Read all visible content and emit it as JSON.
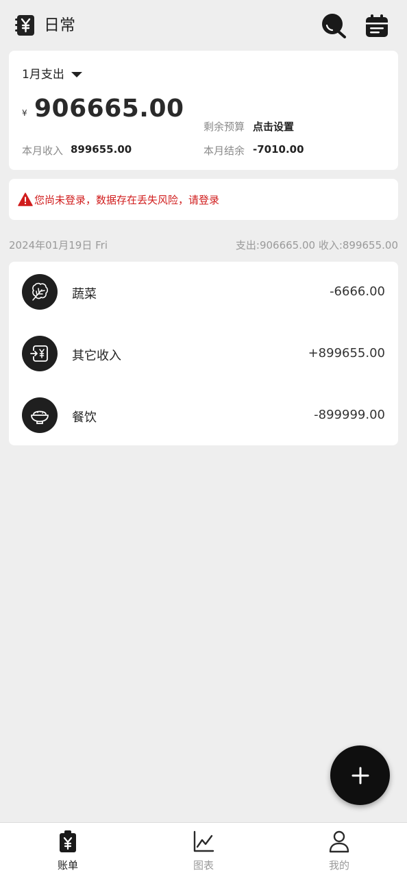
{
  "header": {
    "title": "日常",
    "book_icon": "yen-book-icon",
    "search_icon": "search-icon",
    "calendar_icon": "calendar-icon"
  },
  "summary": {
    "month_label": "1月支出",
    "currency_symbol": "¥",
    "expense_total": "906665.00",
    "budget_label": "剩余预算",
    "budget_action": "点击设置",
    "income_label": "本月收入",
    "income_value": "899655.00",
    "balance_label": "本月结余",
    "balance_value": "-7010.00"
  },
  "warning": {
    "text": "您尚未登录，数据存在丢失风险，请登录",
    "color": "#d01c1c"
  },
  "day": {
    "date": "2024年01月19日 Fri",
    "totals": "支出:906665.00  收入:899655.00"
  },
  "transactions": [
    {
      "name": "蔬菜",
      "amount": "-6666.00",
      "icon": "vegetable-icon"
    },
    {
      "name": "其它收入",
      "amount": "+899655.00",
      "icon": "income-transfer-icon"
    },
    {
      "name": "餐饮",
      "amount": "-899999.00",
      "icon": "rice-bowl-icon"
    }
  ],
  "nav": {
    "items": [
      {
        "label": "账单",
        "icon": "bill-icon",
        "active": true
      },
      {
        "label": "图表",
        "icon": "chart-icon",
        "active": false
      },
      {
        "label": "我的",
        "icon": "profile-icon",
        "active": false
      }
    ]
  },
  "colors": {
    "background": "#eeeeee",
    "card": "#ffffff",
    "accent": "#0f0f0f"
  }
}
